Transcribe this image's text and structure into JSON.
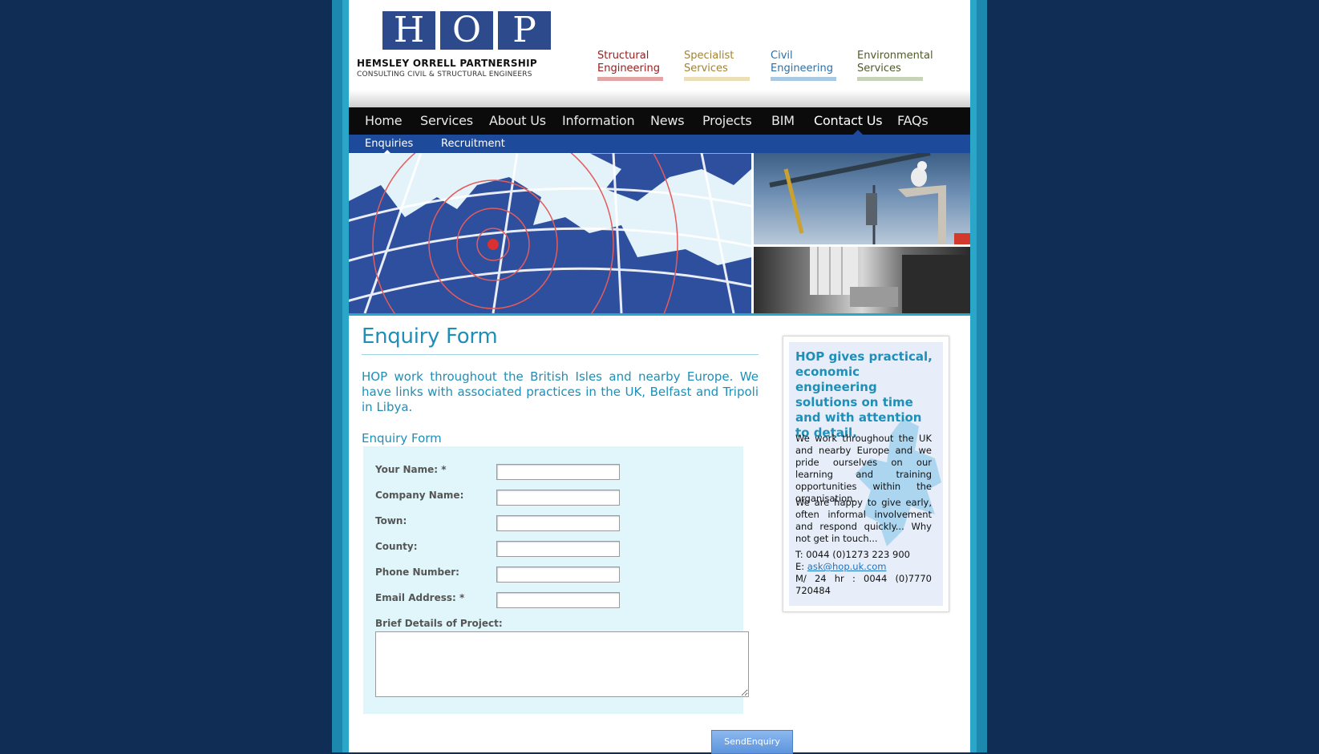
{
  "logo": {
    "letters": [
      "H",
      "O",
      "P"
    ],
    "name": "HEMSLEY ORRELL PARTNERSHIP",
    "tagline": "CONSULTING CIVIL & STRUCTURAL ENGINEERS"
  },
  "services": [
    {
      "line1": "Structural",
      "line2": "Engineering",
      "color": "#9a1b1b",
      "bar": "#e2a5a5"
    },
    {
      "line1": "Specialist",
      "line2": "Services",
      "color": "#a08332",
      "bar": "#eadfb7"
    },
    {
      "line1": "Civil",
      "line2": "Engineering",
      "color": "#2c6fa6",
      "bar": "#a9c9e2"
    },
    {
      "line1": "Environmental",
      "line2": "Services",
      "color": "#4f5a2b",
      "bar": "#c7d2b9"
    }
  ],
  "nav": {
    "items": [
      "Home",
      "Services",
      "About Us",
      "Information",
      "News",
      "Projects",
      "BIM",
      "Contact Us",
      "FAQs"
    ],
    "active": "Contact Us"
  },
  "subnav": {
    "items": [
      "Enquiries",
      "Recruitment"
    ],
    "active": "Enquiries"
  },
  "main": {
    "title": "Enquiry Form",
    "intro": "HOP work throughout the British Isles and nearby Europe. We have links with associated practices in the UK, Belfast and Tripoli in Libya.",
    "form_heading": "Enquiry Form"
  },
  "form": {
    "fields": [
      {
        "label": "Your Name: *",
        "value": ""
      },
      {
        "label": "Company Name:",
        "value": ""
      },
      {
        "label": "Town:",
        "value": ""
      },
      {
        "label": "County:",
        "value": ""
      },
      {
        "label": "Phone Number:",
        "value": ""
      },
      {
        "label": "Email Address: *",
        "value": ""
      }
    ],
    "details_label": "Brief Details of Project:",
    "details_value": "",
    "submit": "SendEnquiry"
  },
  "sidebar": {
    "heading": "HOP gives practical, economic engineering solutions on time and with attention to detail.",
    "para1": "We work throughout the UK and nearby Europe and we pride ourselves on our learning and training opportunities within the organisation.",
    "para2": "We are happy to give early, often informal involvement and respond quickly... Why not get in touch...",
    "phone": "T: 0044 (0)1273 223 900",
    "email_prefix": "E: ",
    "email": "ask@hop.uk.com",
    "mobile": "M/ 24 hr : 0044 (0)7770 720484"
  },
  "colors": {
    "background": "#0f2d55",
    "frame": "#29a6c8",
    "nav": "#0b0b0b",
    "subnav": "#1d4a9a",
    "accent": "#1d8fb8"
  }
}
